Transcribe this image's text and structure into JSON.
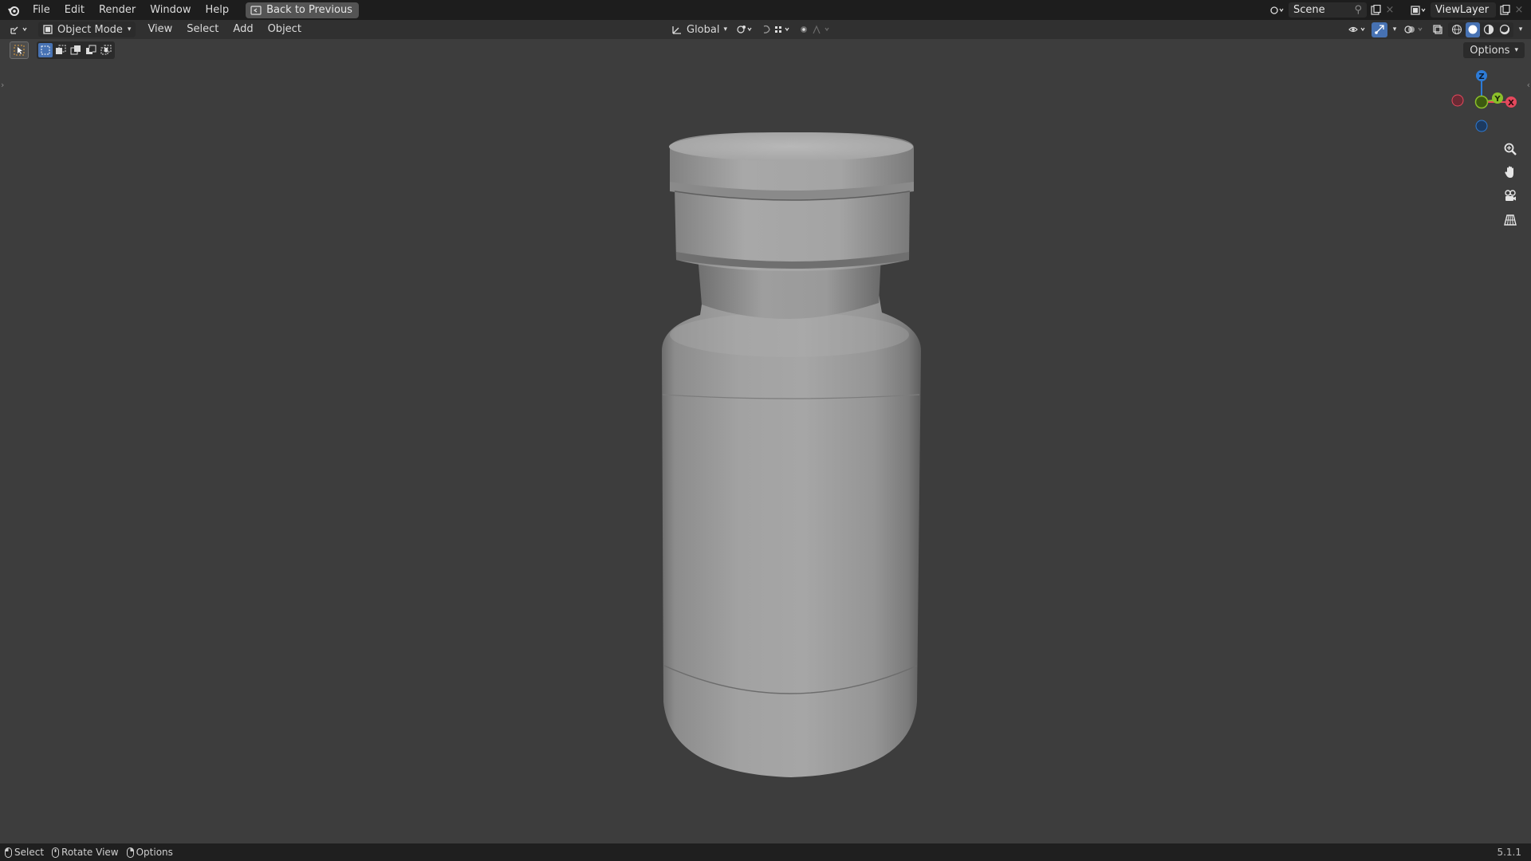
{
  "topbar": {
    "menu": [
      "File",
      "Edit",
      "Render",
      "Window",
      "Help"
    ],
    "back_button": "Back to Previous",
    "scene_name": "Scene",
    "view_layer_name": "ViewLayer"
  },
  "header": {
    "mode": "Object Mode",
    "menu": [
      "View",
      "Select",
      "Add",
      "Object"
    ],
    "transform_orientation": "Global"
  },
  "viewport": {
    "options_label": "Options"
  },
  "gizmo": {
    "x_label": "X",
    "y_label": "Y",
    "z_label": "Z"
  },
  "statusbar": {
    "items": [
      "Select",
      "Rotate View",
      "Options"
    ],
    "version": "5.1.1"
  },
  "colors": {
    "accent": "#4772b3",
    "axis_x": "#e5485c",
    "axis_y": "#8bbf2a",
    "axis_z": "#2d7bd6"
  },
  "icons": [
    "blender-logo-icon",
    "editor-type-icon",
    "object-mode-icon",
    "transform-orientation-icon",
    "snap-icon",
    "proportional-edit-icon",
    "zoom-icon",
    "pan-hand-icon",
    "camera-view-icon",
    "perspective-grid-icon"
  ]
}
